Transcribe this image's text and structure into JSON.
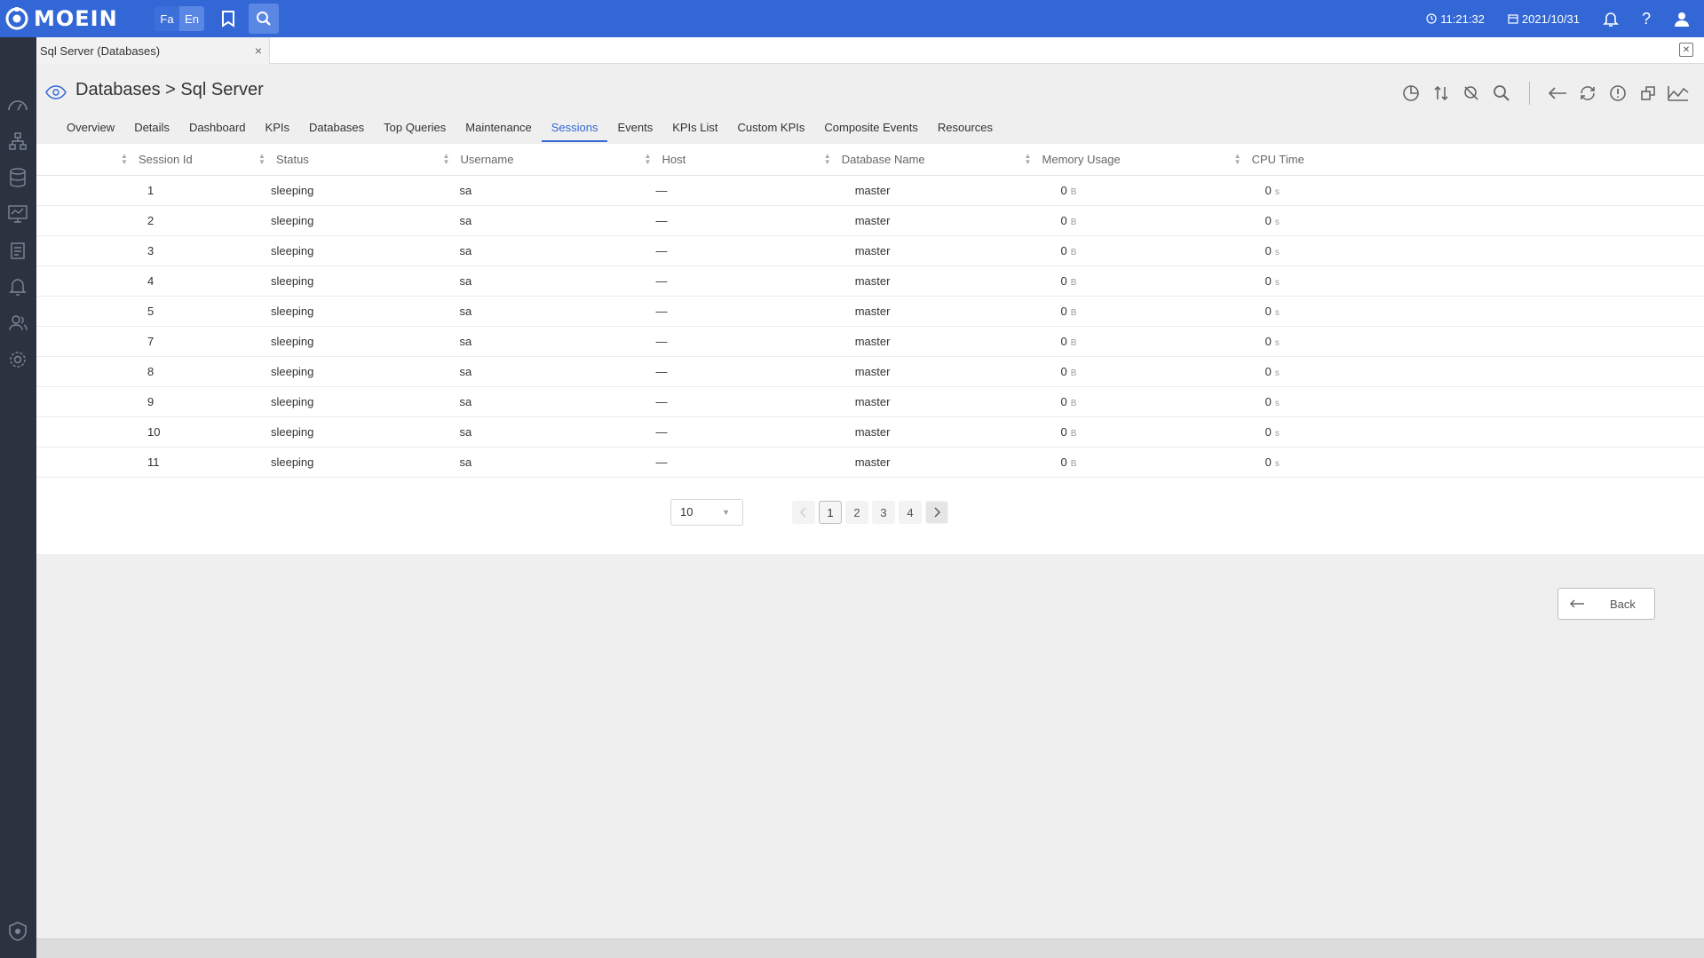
{
  "app": {
    "brand": "MOEIN",
    "lang_fa": "Fa",
    "lang_en": "En",
    "time": "11:21:32",
    "date": "2021/10/31",
    "help": "?"
  },
  "doc_tab": {
    "label": "Sql Server (Databases)",
    "close": "×"
  },
  "header": {
    "title": "Databases > Sql Server"
  },
  "nav_tabs": [
    "Overview",
    "Details",
    "Dashboard",
    "KPIs",
    "Databases",
    "Top Queries",
    "Maintenance",
    "Sessions",
    "Events",
    "KPIs List",
    "Custom KPIs",
    "Composite Events",
    "Resources"
  ],
  "active_tab": "Sessions",
  "table": {
    "columns": [
      "Session Id",
      "Status",
      "Username",
      "Host",
      "Database Name",
      "Memory Usage",
      "CPU Time"
    ],
    "memory_unit": "B",
    "cpu_unit": "s",
    "rows": [
      {
        "id": "1",
        "status": "sleeping",
        "user": "sa",
        "host": "—",
        "db": "master",
        "mem": "0",
        "cpu": "0"
      },
      {
        "id": "2",
        "status": "sleeping",
        "user": "sa",
        "host": "—",
        "db": "master",
        "mem": "0",
        "cpu": "0"
      },
      {
        "id": "3",
        "status": "sleeping",
        "user": "sa",
        "host": "—",
        "db": "master",
        "mem": "0",
        "cpu": "0"
      },
      {
        "id": "4",
        "status": "sleeping",
        "user": "sa",
        "host": "—",
        "db": "master",
        "mem": "0",
        "cpu": "0"
      },
      {
        "id": "5",
        "status": "sleeping",
        "user": "sa",
        "host": "—",
        "db": "master",
        "mem": "0",
        "cpu": "0"
      },
      {
        "id": "7",
        "status": "sleeping",
        "user": "sa",
        "host": "—",
        "db": "master",
        "mem": "0",
        "cpu": "0"
      },
      {
        "id": "8",
        "status": "sleeping",
        "user": "sa",
        "host": "—",
        "db": "master",
        "mem": "0",
        "cpu": "0"
      },
      {
        "id": "9",
        "status": "sleeping",
        "user": "sa",
        "host": "—",
        "db": "master",
        "mem": "0",
        "cpu": "0"
      },
      {
        "id": "10",
        "status": "sleeping",
        "user": "sa",
        "host": "—",
        "db": "master",
        "mem": "0",
        "cpu": "0"
      },
      {
        "id": "11",
        "status": "sleeping",
        "user": "sa",
        "host": "—",
        "db": "master",
        "mem": "0",
        "cpu": "0"
      }
    ]
  },
  "pagination": {
    "page_size": "10",
    "pages": [
      "1",
      "2",
      "3",
      "4"
    ],
    "current": "1"
  },
  "back_button": {
    "label": "Back"
  },
  "colors": {
    "primary": "#3367d6",
    "sidebar": "#2b3240",
    "background": "#efefef"
  },
  "icons": {
    "topbar": [
      "logo-icon",
      "bookmark-icon",
      "search-icon",
      "clock-icon",
      "calendar-icon",
      "bell-icon",
      "help-icon",
      "user-icon"
    ],
    "sidebar": [
      "dashboard-icon",
      "topology-icon",
      "database-icon",
      "monitor-icon",
      "report-icon",
      "alert-icon",
      "users-icon",
      "settings-icon",
      "shield-icon"
    ],
    "toolbar": [
      "chart-icon",
      "sort-icon",
      "filter-off-icon",
      "search-icon",
      "arrow-left-icon",
      "refresh-icon",
      "info-icon",
      "restore-icon",
      "trend-icon"
    ]
  }
}
